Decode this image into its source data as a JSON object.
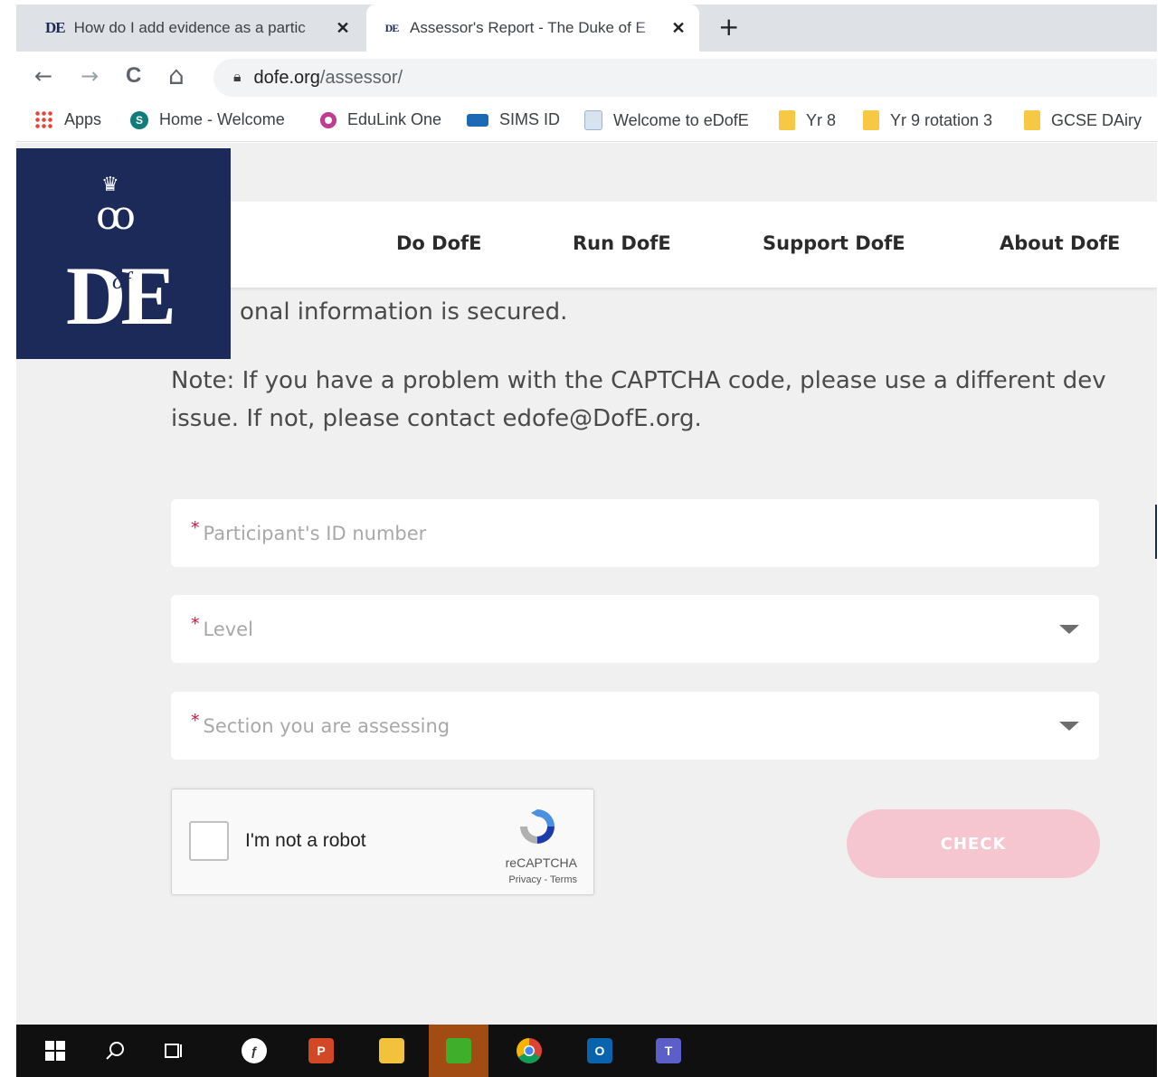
{
  "browser": {
    "tabs": [
      {
        "favicon": "DE",
        "title": "How do I add evidence as a partic",
        "close": "✕"
      },
      {
        "favicon": "DE",
        "title": "Assessor's Report - The Duke of E",
        "close": "✕"
      }
    ],
    "new_tab": "+",
    "nav": {
      "back": "←",
      "forward": "→",
      "reload": "C",
      "home": "⌂"
    },
    "address": {
      "host": "dofe.org",
      "path": "/assessor/"
    },
    "bookmarks": [
      {
        "label": "Apps",
        "icon": "apps-grid-icon"
      },
      {
        "label": "Home - Welcome",
        "icon": "sharepoint-icon"
      },
      {
        "label": "EduLink One",
        "icon": "edulink-icon"
      },
      {
        "label": "SIMS ID",
        "icon": "sims-icon"
      },
      {
        "label": "Welcome to eDofE",
        "icon": "document-icon"
      },
      {
        "label": "Yr 8",
        "icon": "folder-icon"
      },
      {
        "label": "Yr 9 rotation 3",
        "icon": "folder-icon"
      },
      {
        "label": "GCSE DAiry",
        "icon": "folder-icon"
      }
    ]
  },
  "site": {
    "logo": {
      "main": "DE",
      "of": "of"
    },
    "nav": [
      "Do DofE",
      "Run DofE",
      "Support DofE",
      "About DofE"
    ],
    "intro_tail": "onal information is secured.",
    "note_line1": "Note: If you have a problem with the CAPTCHA code, please use a different dev",
    "note_line2": "issue. If not, please contact edofe@DofE.org.",
    "form": {
      "required_mark": "*",
      "participant_id_placeholder": "Participant's ID number",
      "level_placeholder": "Level",
      "section_placeholder": "Section you are assessing",
      "captcha_label": "I'm not a robot",
      "captcha_brand": "reCAPTCHA",
      "captcha_terms": "Privacy - Terms",
      "check_button": "CHECK"
    },
    "colors": {
      "navy": "#1c2a5a",
      "check_disabled": "#f5c6cf",
      "required": "#d1123f"
    }
  },
  "taskbar": {
    "items": [
      "windows-start-icon",
      "search-icon",
      "task-view-icon",
      "flash-icon",
      "powerpoint-icon",
      "file-explorer-icon",
      "green-app-icon",
      "chrome-icon",
      "outlook-icon",
      "teams-icon"
    ]
  }
}
